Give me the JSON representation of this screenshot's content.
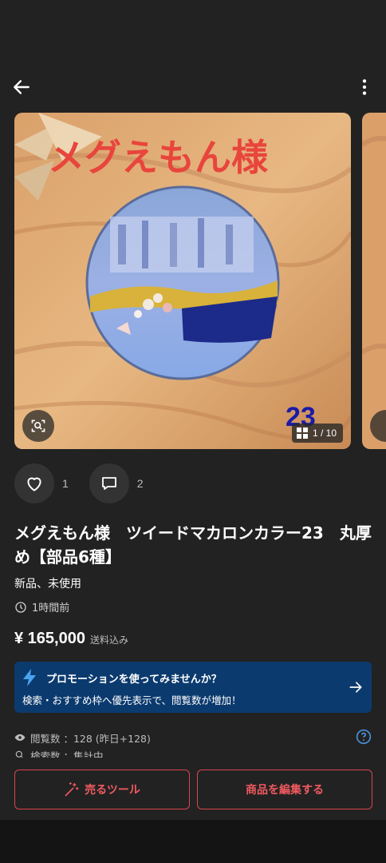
{
  "header": {
    "back_icon": "arrow-left-icon",
    "more_icon": "vertical-dots-icon"
  },
  "gallery": {
    "image_caption": "メグえもん様",
    "image_number": "23",
    "counter": "1 / 10"
  },
  "actions": {
    "like_count": "1",
    "comment_count": "2"
  },
  "item": {
    "title": "メグえもん様　ツイードマカロンカラー23　丸厚め【部品6種】",
    "condition": "新品、未使用",
    "posted": "1時間前",
    "price": "¥ 165,000",
    "shipping": "送料込み"
  },
  "promo": {
    "title": "プロモーションを使ってみませんか？",
    "description": "検索・おすすめ枠へ優先表示で、閲覧数が増加！"
  },
  "stats": {
    "views": "閲覧数 ：128 (昨日+128)",
    "search": "検索数 ：集計中"
  },
  "buttons": {
    "sell_tools": "売るツール",
    "edit_item": "商品を編集する"
  },
  "colors": {
    "accent_red": "#ef5a60",
    "promo_bg": "#0b3a6e",
    "background": "#222222",
    "help_blue": "#4a90d9"
  }
}
